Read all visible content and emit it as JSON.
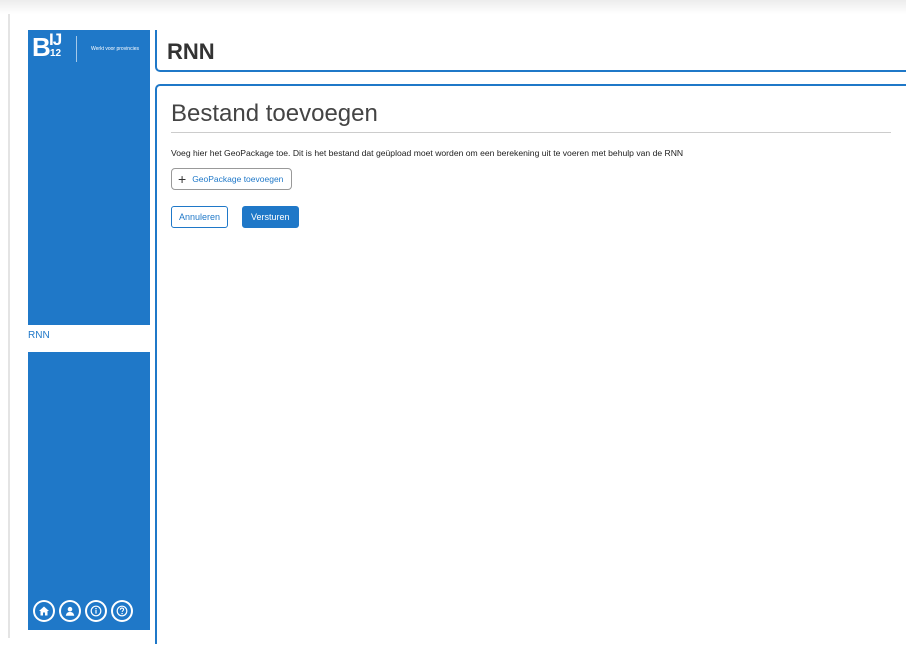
{
  "brand": {
    "logo_letter": "B",
    "logo_ij": "IJ",
    "logo_number": "12",
    "tagline": "Werkt voor provincies"
  },
  "sidebar": {
    "nav_items": [
      {
        "label": "RNN"
      }
    ],
    "footer_icons": [
      "home-icon",
      "user-icon",
      "info-icon",
      "help-icon"
    ]
  },
  "header": {
    "title": "RNN"
  },
  "main": {
    "heading": "Bestand toevoegen",
    "description": "Voeg hier het GeoPackage toe. Dit is het bestand dat geüpload moet worden om een berekening uit te voeren met behulp van de RNN",
    "add_button": {
      "icon": "plus-icon",
      "label": "GeoPackage toevoegen"
    },
    "cancel_label": "Annuleren",
    "submit_label": "Versturen"
  },
  "colors": {
    "accent": "#1f78c8",
    "background": "#ffffff",
    "text": "#222222"
  }
}
